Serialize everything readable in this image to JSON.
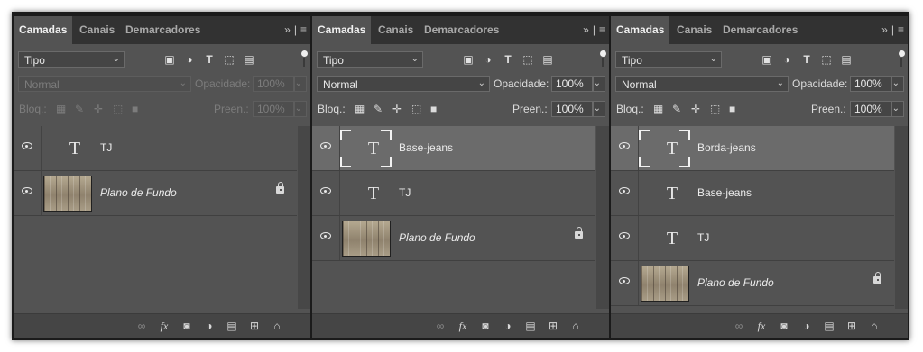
{
  "tabs": {
    "layers": "Camadas",
    "channels": "Canais",
    "markers": "Demarcadores"
  },
  "filter": {
    "kind": "Tipo"
  },
  "labels": {
    "opacity": "Opacidade:",
    "lock": "Bloq.:",
    "fill": "Preen.:"
  },
  "panels": [
    {
      "blend_mode": "Normal",
      "opacity": "100%",
      "fill": "100%",
      "disabled": true,
      "layers": [
        {
          "type": "text",
          "name": "TJ",
          "selected": false,
          "locked": false
        },
        {
          "type": "image",
          "name": "Plano de Fundo",
          "selected": false,
          "locked": true
        }
      ]
    },
    {
      "blend_mode": "Normal",
      "opacity": "100%",
      "fill": "100%",
      "disabled": false,
      "layers": [
        {
          "type": "text",
          "name": "Base-jeans",
          "selected": true,
          "locked": false
        },
        {
          "type": "text",
          "name": "TJ",
          "selected": false,
          "locked": false
        },
        {
          "type": "image",
          "name": "Plano de Fundo",
          "selected": false,
          "locked": true
        }
      ]
    },
    {
      "blend_mode": "Normal",
      "opacity": "100%",
      "fill": "100%",
      "disabled": false,
      "layers": [
        {
          "type": "text",
          "name": "Borda-jeans",
          "selected": true,
          "locked": false
        },
        {
          "type": "text",
          "name": "Base-jeans",
          "selected": false,
          "locked": false
        },
        {
          "type": "text",
          "name": "TJ",
          "selected": false,
          "locked": false
        },
        {
          "type": "image",
          "name": "Plano de Fundo",
          "selected": false,
          "locked": true
        }
      ]
    }
  ],
  "icons": {
    "tab_menu": [
      "expand-icon",
      "menu-icon"
    ],
    "filter": [
      "pixel-filter-icon",
      "adjustment-filter-icon",
      "type-filter-icon",
      "shape-filter-icon",
      "smart-object-filter-icon"
    ],
    "lock": [
      "lock-transparent-icon",
      "lock-image-icon",
      "lock-position-icon",
      "lock-artboard-icon",
      "lock-all-icon"
    ],
    "footer": [
      "link-icon",
      "fx-icon",
      "mask-icon",
      "adjustment-layer-icon",
      "group-icon",
      "new-layer-icon",
      "delete-icon"
    ]
  },
  "colors": {
    "panel": "#535353",
    "tabbar": "#323232",
    "selected_row": "#6b6b6b",
    "footer": "#454545",
    "text": "#ececec"
  }
}
